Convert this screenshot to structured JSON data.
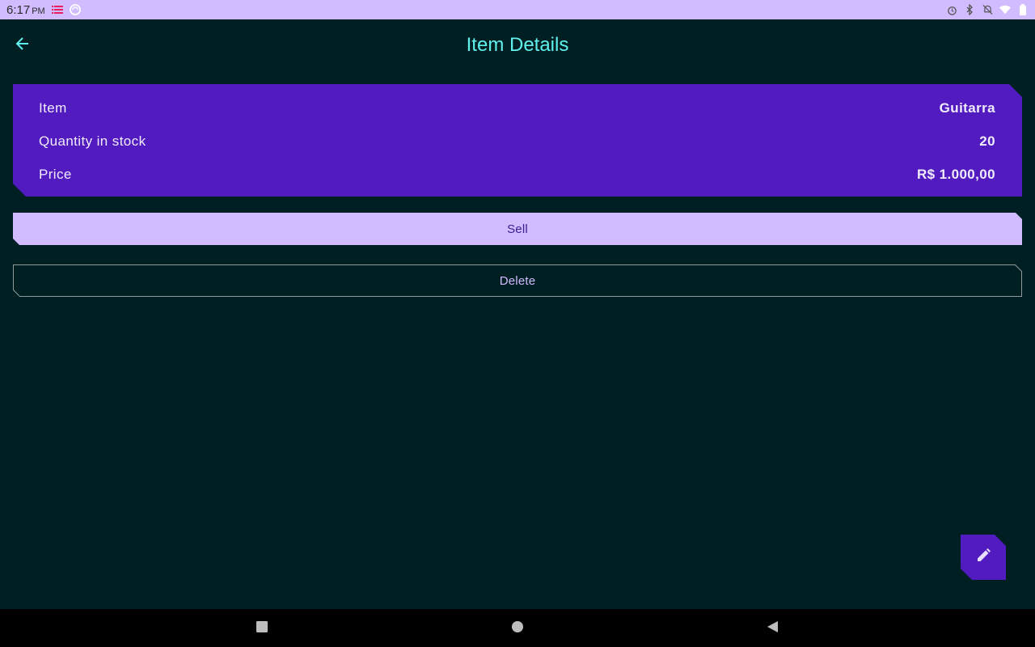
{
  "status_bar": {
    "time": "6:17",
    "ampm": "PM",
    "icons": [
      "list-notification-icon",
      "sync-icon",
      "alarm-icon",
      "bluetooth-icon",
      "notifications-off-icon",
      "wifi-icon",
      "battery-icon"
    ]
  },
  "app_bar": {
    "title": "Item Details",
    "back_icon": "arrow-back-icon"
  },
  "details": {
    "rows": [
      {
        "label": "Item",
        "value": "Guitarra"
      },
      {
        "label": "Quantity in stock",
        "value": "20"
      },
      {
        "label": "Price",
        "value": "R$ 1.000,00"
      }
    ]
  },
  "actions": {
    "sell_label": "Sell",
    "delete_label": "Delete"
  },
  "fab": {
    "icon": "edit-pencil-icon"
  },
  "nav_bar": {
    "icons": [
      "recents-square-icon",
      "home-circle-icon",
      "back-triangle-icon"
    ]
  },
  "colors": {
    "background": "#001f23",
    "card": "#521bbf",
    "accent_light": "#d0bcff",
    "title": "#5ff1ee"
  }
}
